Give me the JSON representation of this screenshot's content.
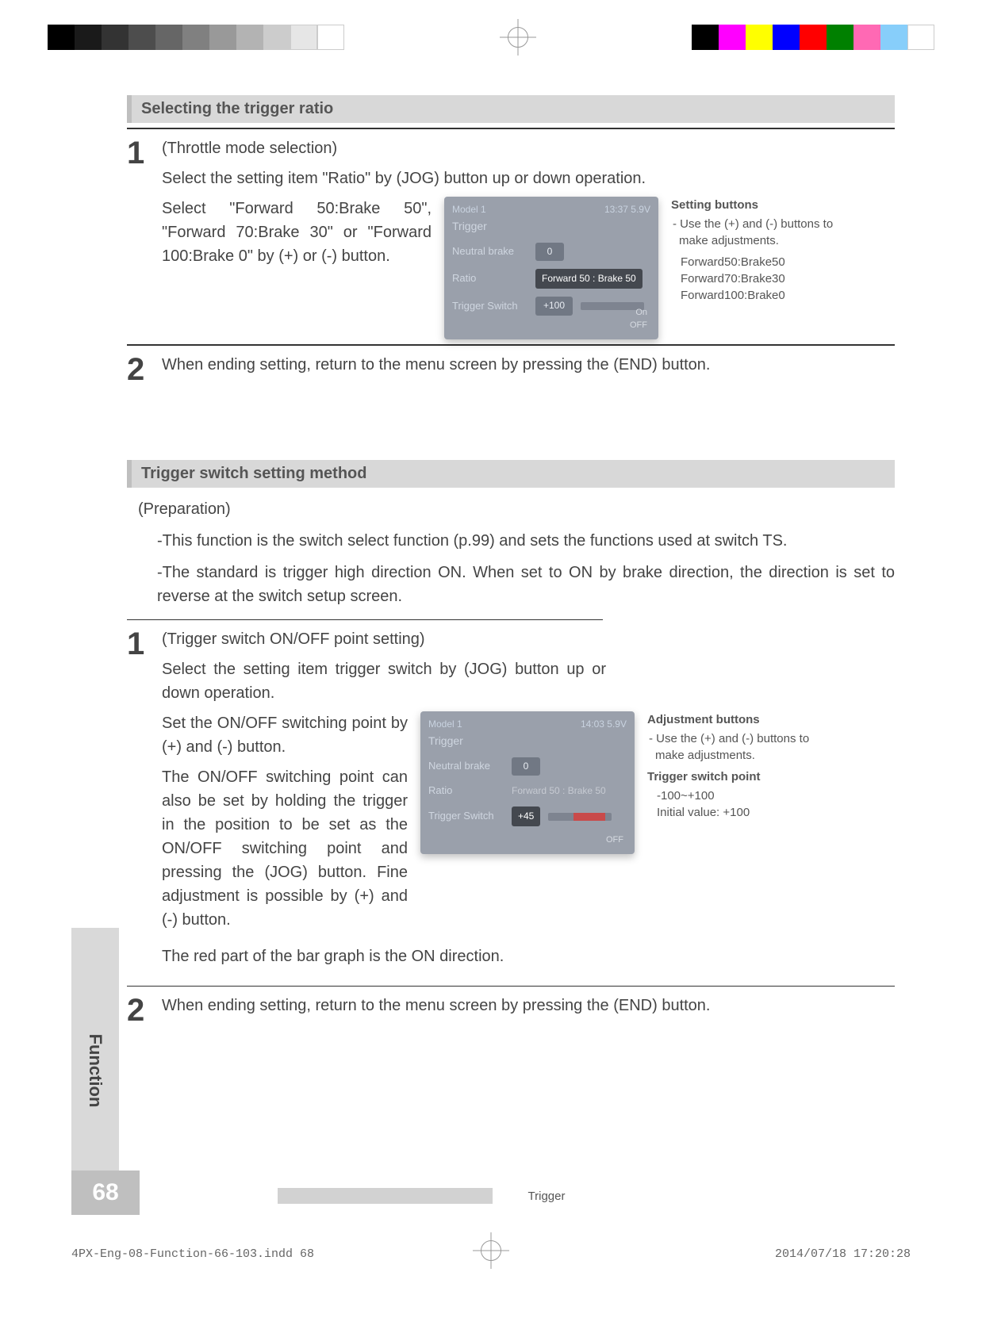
{
  "registration": {
    "gray_steps": [
      "#000",
      "#1a1a1a",
      "#333",
      "#4d4d4d",
      "#666",
      "#808080",
      "#999",
      "#b3b3b3",
      "#ccc",
      "#e6e6e6",
      "#fff"
    ],
    "color_bar": [
      "#000",
      "#ff00ff",
      "#ffff00",
      "#0000ff",
      "#ff0000",
      "#008000",
      "#ff69b4",
      "#87cefa",
      "#fff"
    ]
  },
  "section1": {
    "heading": "Selecting the trigger ratio",
    "step1": {
      "num": "1",
      "title": "(Throttle mode selection)",
      "line1": "Select the setting item \"Ratio\" by (JOG) button up or down operation.",
      "line2": "Select \"Forward 50:Brake 50\", \"Forward 70:Brake 30\" or \"Forward 100:Brake 0\" by (+) or (-) button."
    },
    "lcd": {
      "model": "Model 1",
      "time": "13:37 5.9V",
      "title": "Trigger",
      "r1_label": "Neutral brake",
      "r1_val": "0",
      "r2_label": "Ratio",
      "r2_val": "Forward 50 : Brake 50",
      "r3_label": "Trigger Switch",
      "r3_val": "+100",
      "on": "On",
      "off": "OFF"
    },
    "note": {
      "heading": "Setting buttons",
      "line1": "- Use the (+) and (-) buttons to make adjustments.",
      "opt1": "Forward50:Brake50",
      "opt2": "Forward70:Brake30",
      "opt3": "Forward100:Brake0"
    },
    "step2": {
      "num": "2",
      "text": "When ending setting, return to the menu screen by pressing the (END) button."
    }
  },
  "section2": {
    "heading": "Trigger switch setting method",
    "prep_label": "(Preparation)",
    "prep1": "-This function is the switch select function (p.99) and sets the functions used at switch TS.",
    "prep2": "-The standard is trigger high direction ON. When set to ON by brake direction, the direction is set to reverse at the switch setup screen.",
    "step1": {
      "num": "1",
      "title": "(Trigger switch ON/OFF point setting)",
      "line1": "Select the setting item trigger switch by (JOG) button up or down operation.",
      "line2": "Set the ON/OFF switching point by (+) and (-) button.",
      "line3": "The ON/OFF switching point can also be set by holding the trigger in the position to be set as the ON/OFF switching point and pressing the (JOG) button. Fine adjustment is possible by (+) and (-) button.",
      "line4": "The red part of the bar graph is the ON direction."
    },
    "lcd": {
      "model": "Model 1",
      "time": "14:03 5.9V",
      "title": "Trigger",
      "r1_label": "Neutral brake",
      "r1_val": "0",
      "r2_label": "Ratio",
      "r2_val": "Forward 50 : Brake 50",
      "r3_label": "Trigger Switch",
      "r3_val": "+45",
      "off": "OFF"
    },
    "note": {
      "heading": "Adjustment buttons",
      "line1": "- Use the (+) and (-) buttons to make adjustments.",
      "sub_heading": "Trigger switch point",
      "range": "-100~+100",
      "initial": "Initial value: +100"
    },
    "step2": {
      "num": "2",
      "text": "When ending setting, return to the menu screen by pressing the (END) button."
    }
  },
  "side_tab": "Function",
  "page_number": "68",
  "footer_center": "Trigger",
  "indd_left": "4PX-Eng-08-Function-66-103.indd   68",
  "indd_right": "2014/07/18   17:20:28"
}
